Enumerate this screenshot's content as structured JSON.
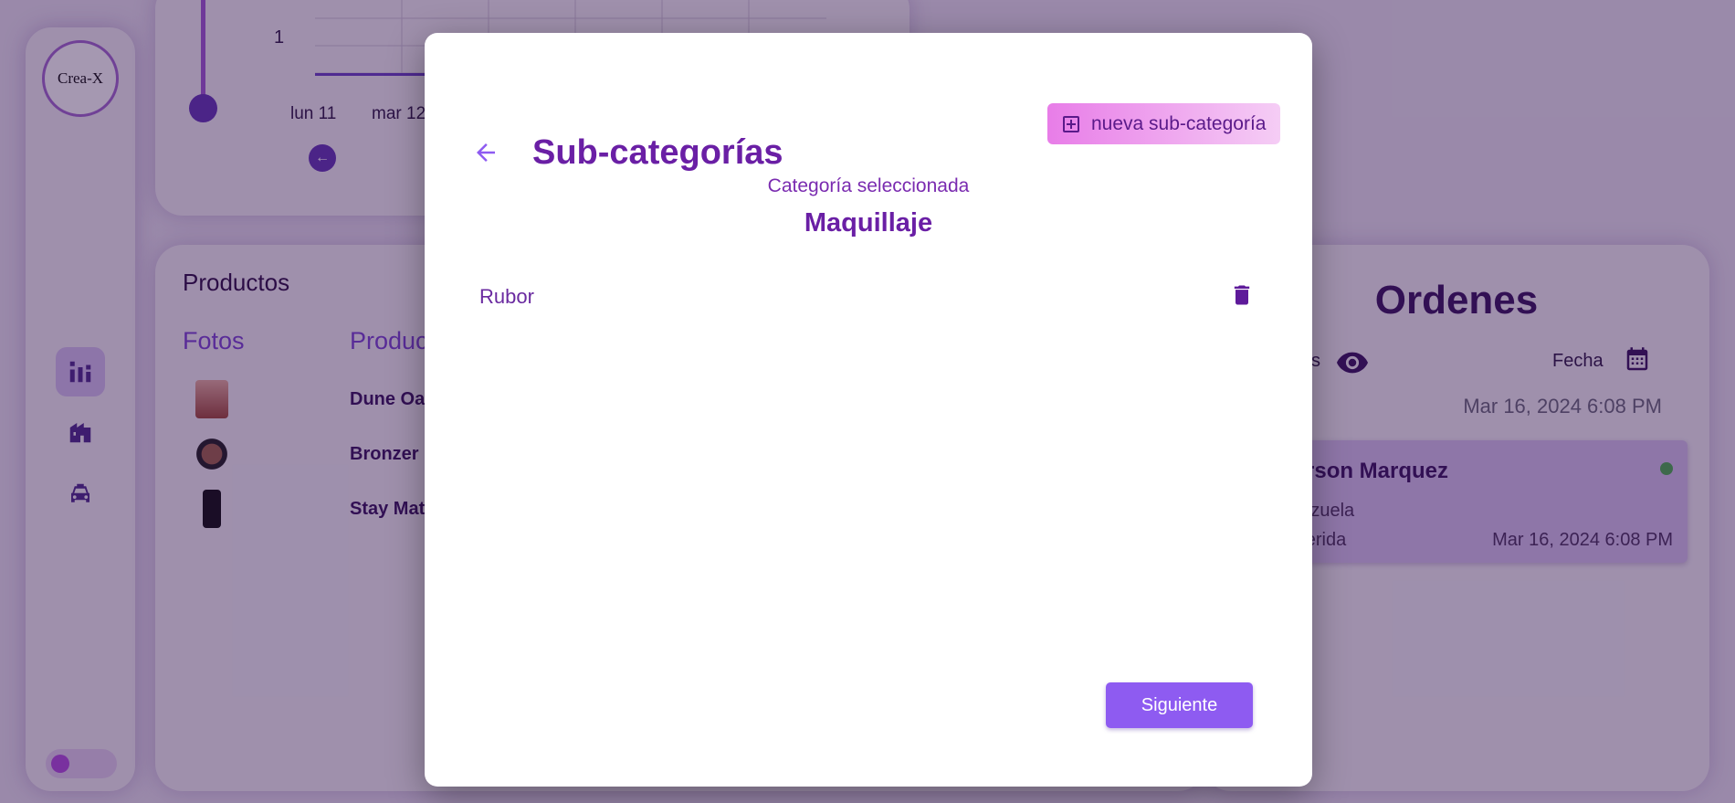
{
  "sidebar": {
    "logo_text": "Crea-X",
    "nav": [
      {
        "icon": "bar-chart-icon",
        "active": true
      },
      {
        "icon": "store-icon",
        "active": false
      },
      {
        "icon": "taxi-icon",
        "active": false
      }
    ]
  },
  "chart": {
    "y_tick": "1",
    "x_ticks": [
      "lun 11",
      "mar 12"
    ]
  },
  "products": {
    "title": "Productos",
    "columns": [
      "Fotos",
      "Produc"
    ],
    "rows": [
      {
        "name": "Dune Oa"
      },
      {
        "name": "Bronzer"
      },
      {
        "name": "Stay Mat"
      }
    ]
  },
  "orders": {
    "title": "Ordenes",
    "filter_left": "s",
    "filter_date": "Fecha",
    "current_date": "Mar 16, 2024 6:08 PM",
    "order": {
      "name": "derson Marquez",
      "country": "enezuela",
      "city": ": Merida",
      "date": "Mar 16, 2024 6:08 PM",
      "status_color": "#4caf50"
    }
  },
  "modal": {
    "title": "Sub-categorías",
    "new_button_label": "nueva sub-categoría",
    "selected_label": "Categoría seleccionada",
    "selected_category": "Maquillaje",
    "subcategories": [
      {
        "label": "Rubor"
      }
    ],
    "next_button_label": "Siguiente"
  },
  "colors": {
    "primary": "#6a1fa5",
    "button": "#8e5bf1",
    "accent_gradient_start": "#e87de8"
  }
}
